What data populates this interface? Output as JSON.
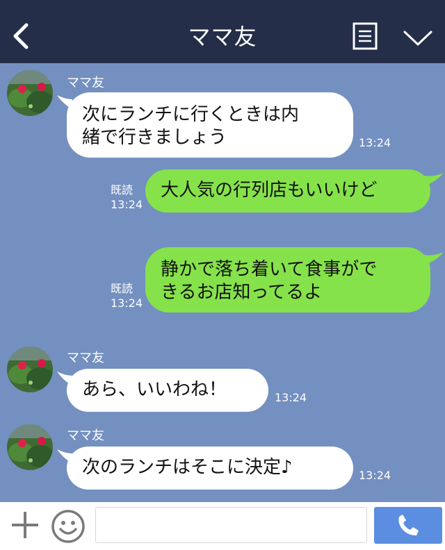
{
  "header": {
    "title": "ママ友"
  },
  "messages": [
    {
      "sender": "ママ友",
      "text_line1": "次にランチに行くときは内",
      "text_line2": "緒で行きましょう",
      "time": "13:24"
    },
    {
      "read": "既読",
      "time": "13:24",
      "text": "大人気の行列店もいいけど"
    },
    {
      "read": "既読",
      "time": "13:24",
      "text_line1": "静かで落ち着いて食事がで",
      "text_line2": "きるお店知ってるよ"
    },
    {
      "sender": "ママ友",
      "text": "あら、いいわね！",
      "time": "13:24"
    },
    {
      "sender": "ママ友",
      "text": "次のランチはそこに決定♪",
      "time": "13:24"
    }
  ],
  "input": {
    "placeholder": ""
  },
  "colors": {
    "header_bg": "#242e48",
    "chat_bg": "#7490c0",
    "outgoing_bubble": "#86e24a",
    "incoming_bubble": "#ffffff",
    "call_button": "#5b8ee0"
  },
  "icons": {
    "back": "chevron-left-icon",
    "menu": "list-icon",
    "collapse": "chevron-down-icon",
    "plus": "plus-icon",
    "emoji": "smiley-icon",
    "call": "phone-icon"
  }
}
